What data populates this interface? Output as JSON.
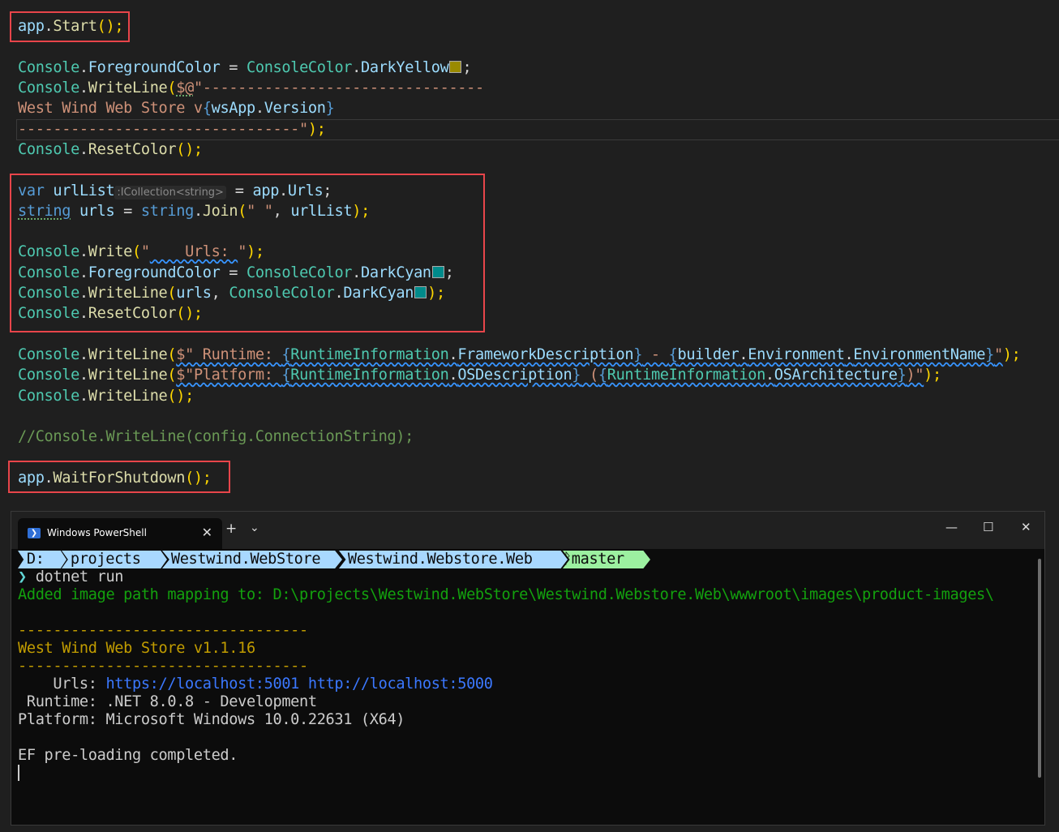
{
  "code": {
    "l1": {
      "a": "app",
      "b": ".",
      "c": "Start",
      "d": "();"
    },
    "l2": {
      "a": "Console",
      "b": ".",
      "c": "ForegroundColor",
      "d": " = ",
      "e": "ConsoleColor",
      "f": ".",
      "g": "DarkYellow",
      "h": ";"
    },
    "l3": {
      "a": "Console",
      "b": ".",
      "c": "WriteLine",
      "d": "(",
      "e": "$@",
      "f": "\"--------------------------------"
    },
    "l4": {
      "a": "West Wind Web Store v",
      "b": "{",
      "c": "wsApp",
      "d": ".",
      "e": "Version",
      "f": "}"
    },
    "l5": {
      "a": "--------------------------------\"",
      "b": ");"
    },
    "l6": {
      "a": "Console",
      "b": ".",
      "c": "ResetColor",
      "d": "();"
    },
    "l7": {
      "a": "var",
      "b": " ",
      "c": "urlList",
      "hint": ":ICollection<string>",
      "d": " = ",
      "e": "app",
      "f": ".",
      "g": "Urls",
      "h": ";"
    },
    "l8": {
      "a": "string",
      "b": " ",
      "c": "urls",
      "d": " = ",
      "e": "string",
      "f": ".",
      "g": "Join",
      "h": "(",
      "i": "\" \"",
      "j": ", ",
      "k": "urlList",
      "l": ");"
    },
    "l9": {
      "a": "Console",
      "b": ".",
      "c": "Write",
      "d": "(",
      "e": "\"",
      "f": "    Urls: ",
      "g": "\"",
      "h": ");"
    },
    "l10": {
      "a": "Console",
      "b": ".",
      "c": "ForegroundColor",
      "d": " = ",
      "e": "ConsoleColor",
      "f": ".",
      "g": "DarkCyan",
      "h": ";"
    },
    "l11": {
      "a": "Console",
      "b": ".",
      "c": "WriteLine",
      "d": "(",
      "e": "urls",
      "f": ", ",
      "g": "ConsoleColor",
      "h": ".",
      "i": "DarkCyan",
      "j": ");"
    },
    "l12": {
      "a": "Console",
      "b": ".",
      "c": "ResetColor",
      "d": "();"
    },
    "l13": {
      "a": "Console",
      "b": ".",
      "c": "WriteLine",
      "d": "(",
      "e": "$\" Runtime: ",
      "f": "{",
      "g": "RuntimeInformation",
      "h": ".",
      "i": "FrameworkDescription",
      "j": "}",
      "k": " - ",
      "l": "{",
      "m": "builder",
      "n": ".",
      "o": "Environment",
      "p": ".",
      "q": "EnvironmentName",
      "r": "}",
      "s": "\"",
      "t": ");"
    },
    "l14": {
      "a": "Console",
      "b": ".",
      "c": "WriteLine",
      "d": "(",
      "e": "$\"Platform: ",
      "f": "{",
      "g": "RuntimeInformation",
      "h": ".",
      "i": "OSDescription",
      "j": "}",
      "k": " (",
      "l": "{",
      "m": "RuntimeInformation",
      "n": ".",
      "o": "OSArchitecture",
      "p": "}",
      "q": ")\"",
      "r": ");"
    },
    "l15": {
      "a": "Console",
      "b": ".",
      "c": "WriteLine",
      "d": "();"
    },
    "l16": {
      "a": "//Console.WriteLine(config.ConnectionString);"
    },
    "l17": {
      "a": "app",
      "b": ".",
      "c": "WaitForShutdown",
      "d": "();"
    },
    "swatch_yellow": "#9a8a00",
    "swatch_cyan": "#008b8b"
  },
  "terminal": {
    "tab_title": "Windows PowerShell",
    "tab_icon": "❯",
    "close_tab": "✕",
    "new_tab": "+",
    "dropdown": "⌄",
    "minimize": "—",
    "maximize": "☐",
    "close_window": "✕",
    "prompt_segments": [
      " D: ",
      " projects ",
      " Westwind.WebStore ",
      " Westwind.Webstore.Web ",
      "ᚹmaster "
    ],
    "prompt_colors": [
      "#a8d8ff",
      "#a8d8ff",
      "#a8d8ff",
      "#a8d8ff",
      "#9cf0a0"
    ],
    "command_prompt": "❯",
    "command": " dotnet run",
    "line_mapping": "Added image path mapping to: D:\\projects\\Westwind.WebStore\\Westwind.Webstore.Web\\wwwroot\\images\\product-images\\",
    "dash1": "---------------------------------",
    "banner": "West Wind Web Store v1.1.16",
    "dash2": "---------------------------------",
    "urls_label": "    Urls: ",
    "urls_value": "https://localhost:5001 http://localhost:5000",
    "runtime": " Runtime: .NET 8.0.8 - Development",
    "platform": "Platform: Microsoft Windows 10.0.22631 (X64)",
    "ef": "EF pre-loading completed."
  }
}
